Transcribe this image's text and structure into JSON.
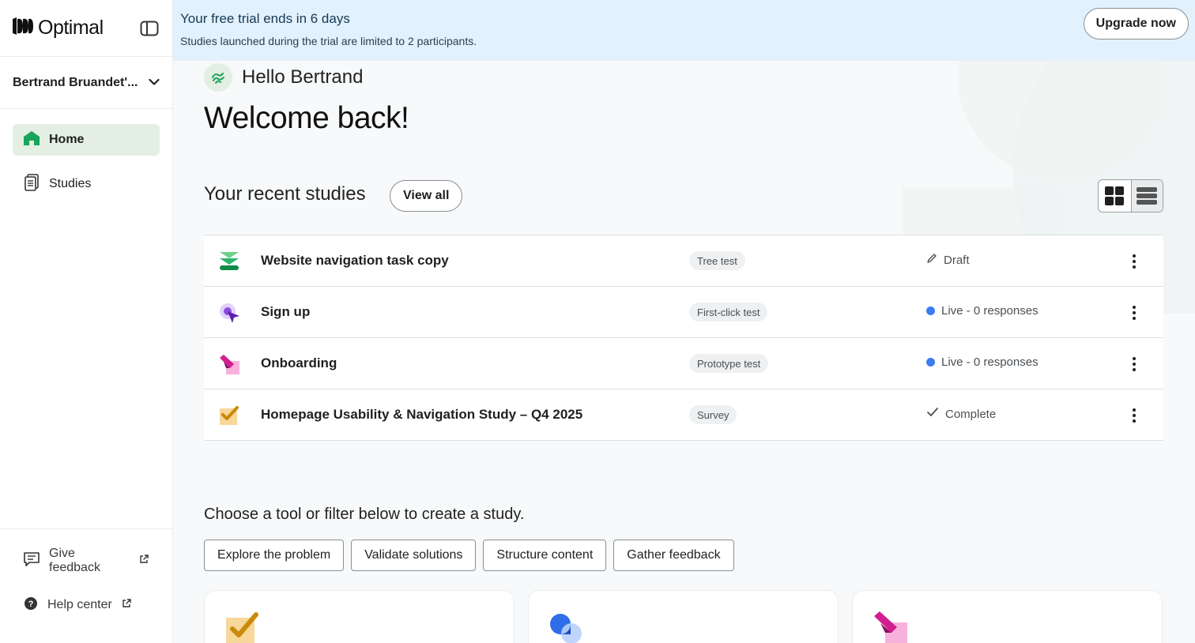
{
  "app": {
    "name": "Optimal"
  },
  "sidebar": {
    "org_name": "Bertrand Bruandet'...",
    "nav": [
      {
        "label": "Home",
        "active": true,
        "icon": "home-icon"
      },
      {
        "label": "Studies",
        "active": false,
        "icon": "studies-icon"
      }
    ],
    "bottom": [
      {
        "label": "Give feedback",
        "icon": "feedback-icon"
      },
      {
        "label": "Help center",
        "icon": "help-icon"
      }
    ]
  },
  "banner": {
    "title": "Your free trial ends in 6 days",
    "subtitle": "Studies launched during the trial are limited to 2 participants.",
    "cta": "Upgrade now"
  },
  "main": {
    "greeting": "Hello Bertrand",
    "welcome": "Welcome back!",
    "recent_title": "Your recent studies",
    "view_all": "View all",
    "choose_text": "Choose a tool or filter below to create a study."
  },
  "studies": [
    {
      "name": "Website navigation task copy",
      "type": "Tree test",
      "status": "Draft",
      "status_kind": "draft",
      "icon": "tree-test-icon"
    },
    {
      "name": "Sign up",
      "type": "First-click test",
      "status": "Live - 0 responses",
      "status_kind": "live",
      "icon": "first-click-icon"
    },
    {
      "name": "Onboarding",
      "type": "Prototype test",
      "status": "Live - 0 responses",
      "status_kind": "live",
      "icon": "prototype-icon"
    },
    {
      "name": "Homepage Usability & Navigation Study – Q4 2025",
      "type": "Survey",
      "status": "Complete",
      "status_kind": "complete",
      "icon": "survey-icon"
    }
  ],
  "filters": [
    "Explore the problem",
    "Validate solutions",
    "Structure content",
    "Gather feedback"
  ],
  "colors": {
    "accent_green": "#1aa35b",
    "live_blue": "#3b7cf0",
    "banner_bg": "#e2f1fb",
    "nav_active_bg": "#e3efe2"
  }
}
